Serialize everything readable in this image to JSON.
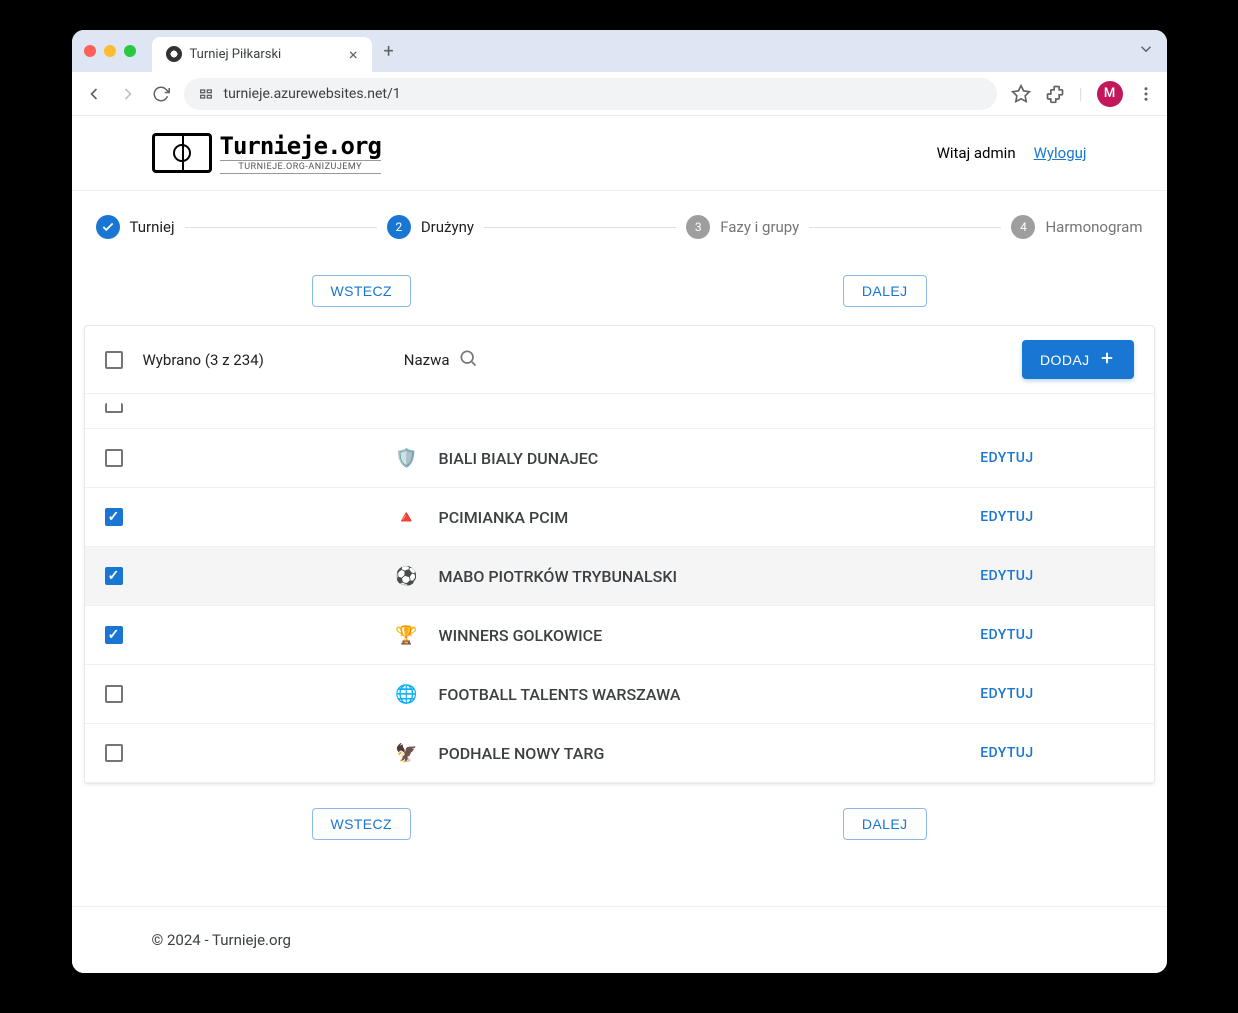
{
  "browser": {
    "tab_title": "Turniej Piłkarski",
    "url": "turnieje.azurewebsites.net/1",
    "avatar_letter": "M"
  },
  "header": {
    "logo_title": "Turnieje.org",
    "logo_sub": "TURNIEJE.ORG-ANIZUJEMY",
    "welcome": "Witaj admin",
    "logout": "Wyloguj"
  },
  "stepper": {
    "steps": [
      {
        "num": "✓",
        "label": "Turniej",
        "state": "done"
      },
      {
        "num": "2",
        "label": "Drużyny",
        "state": "active"
      },
      {
        "num": "3",
        "label": "Fazy i grupy",
        "state": "pending"
      },
      {
        "num": "4",
        "label": "Harmonogram",
        "state": "pending"
      }
    ]
  },
  "nav": {
    "back": "WSTECZ",
    "next": "DALEJ"
  },
  "table": {
    "selected_text": "Wybrano (3 z 234)",
    "name_header": "Nazwa",
    "add_button": "DODAJ",
    "edit_label": "EDYTUJ",
    "rows": [
      {
        "name": "BIALI BIALY DUNAJEC",
        "checked": false,
        "logo_bg": "#d4a055",
        "logo_emoji": "🛡️"
      },
      {
        "name": "PCIMIANKA PCIM",
        "checked": true,
        "logo_bg": "#8b1a1a",
        "logo_emoji": "🔺"
      },
      {
        "name": "MABO PIOTRKÓW TRYBUNALSKI",
        "checked": true,
        "logo_bg": "#4caf50",
        "logo_emoji": "⚽",
        "hovered": true
      },
      {
        "name": "WINNERS GOLKOWICE",
        "checked": true,
        "logo_bg": "#b71c1c",
        "logo_emoji": "🏆"
      },
      {
        "name": "FOOTBALL TALENTS WARSZAWA",
        "checked": false,
        "logo_bg": "#1976d2",
        "logo_emoji": "🌐"
      },
      {
        "name": "PODHALE NOWY TARG",
        "checked": false,
        "logo_bg": "#6a1b9a",
        "logo_emoji": "🦅"
      }
    ]
  },
  "footer": {
    "text": "© 2024 - Turnieje.org"
  }
}
